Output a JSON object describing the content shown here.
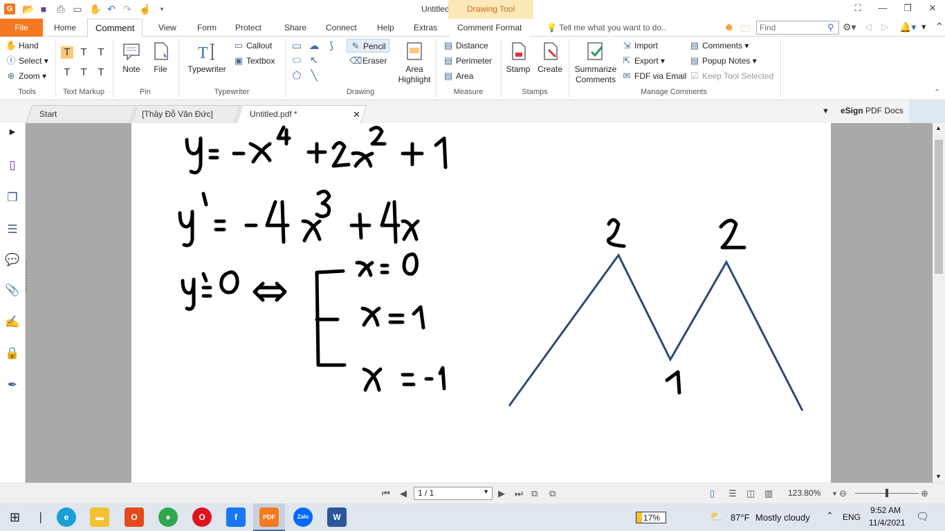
{
  "window": {
    "title": "Untitled.pdf * - Foxit Reader",
    "contextual_tab": "Drawing Tool"
  },
  "tabs": [
    "File",
    "Home",
    "Comment",
    "View",
    "Form",
    "Protect",
    "Share",
    "Connect",
    "Help",
    "Extras",
    "Comment Format"
  ],
  "tellme_placeholder": "Tell me what you want to do..",
  "find_placeholder": "Find",
  "ribbon": {
    "tools": {
      "label": "Tools",
      "hand": "Hand",
      "select": "Select",
      "zoom": "Zoom"
    },
    "text_markup": {
      "label": "Text Markup"
    },
    "pin": {
      "label": "Pin",
      "note": "Note",
      "file": "File"
    },
    "typewriter": {
      "label": "Typewriter",
      "typewriter": "Typewriter",
      "callout": "Callout",
      "textbox": "Textbox"
    },
    "drawing": {
      "label": "Drawing",
      "pencil": "Pencil",
      "eraser": "Eraser",
      "area_highlight": "Area Highlight"
    },
    "measure": {
      "label": "Measure",
      "distance": "Distance",
      "perimeter": "Perimeter",
      "area": "Area"
    },
    "stamps": {
      "label": "Stamps",
      "stamp": "Stamp",
      "create": "Create"
    },
    "manage": {
      "label": "Manage Comments",
      "summarize": "Summarize Comments",
      "import": "Import",
      "export": "Export",
      "fdf_email": "FDF via Email",
      "comments": "Comments",
      "popup_notes": "Popup Notes",
      "keep_tool": "Keep Tool Selected"
    }
  },
  "doc_tabs": [
    "Start",
    "[Thầy Đỗ Văn Đức] T...",
    "Untitled.pdf *"
  ],
  "esign": {
    "brand": "eSign",
    "suffix": "PDF Docs"
  },
  "canvas": {
    "handwriting": [
      "y = -x⁴ + 2x² + 1",
      "y' = -4x³ + 4x",
      "y' = 0 ⟺",
      "x = 0",
      "x = 1",
      "x = -1",
      "2",
      "2",
      "1"
    ],
    "stroke_color": "#2b4b73"
  },
  "status": {
    "page": "1 / 1",
    "zoom": "123.80%"
  },
  "taskbar": {
    "battery": "17%",
    "temp": "87°F",
    "weather": "Mostly cloudy",
    "lang": "ENG",
    "time": "9:52 AM",
    "date": "11/4/2021",
    "apps": [
      "zalo-label",
      "word-label",
      "office-label",
      "foxit-label"
    ],
    "app_labels": {
      "zalo": "Zalo",
      "word": "W",
      "office": "O",
      "pdf": "PDF"
    }
  },
  "colors": {
    "accent": "#f47920",
    "tab_highlight": "#fde9b8",
    "taskbar": "#dfe6ed"
  }
}
